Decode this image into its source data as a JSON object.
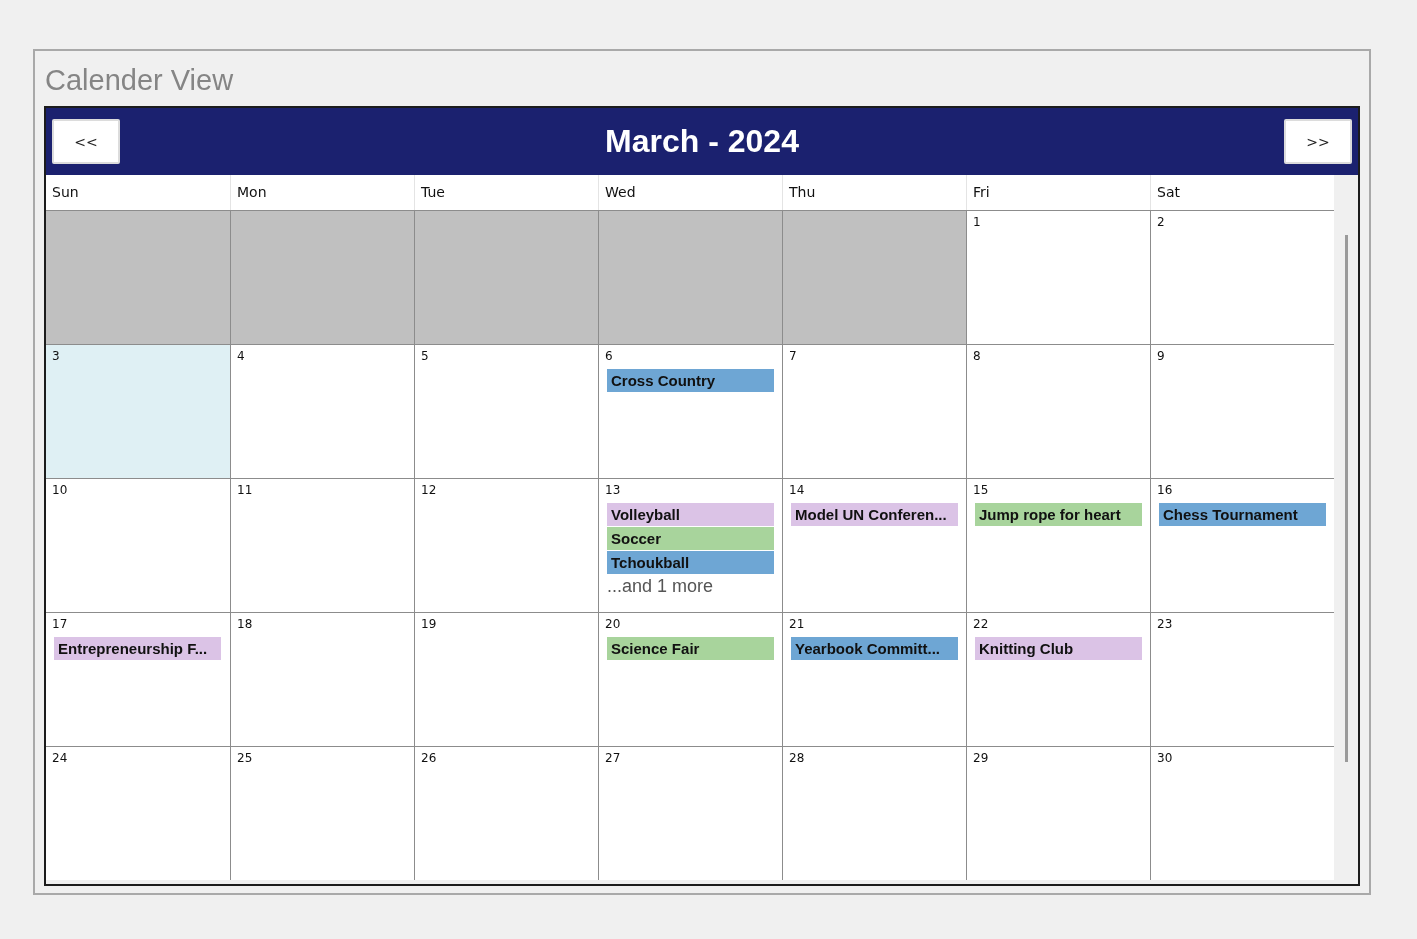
{
  "panel": {
    "title": "Calender View"
  },
  "header": {
    "prev": "<<",
    "month": "March - 2024",
    "next": ">>"
  },
  "weekdays": [
    "Sun",
    "Mon",
    "Tue",
    "Wed",
    "Thu",
    "Fri",
    "Sat"
  ],
  "weeks": [
    [
      {
        "kind": "blank"
      },
      {
        "kind": "blank"
      },
      {
        "kind": "blank"
      },
      {
        "kind": "blank"
      },
      {
        "kind": "blank"
      },
      {
        "kind": "day",
        "day": "1",
        "selected": false
      },
      {
        "kind": "day",
        "day": "2",
        "selected": false
      }
    ],
    [
      {
        "kind": "day",
        "day": "3",
        "selected": true
      },
      {
        "kind": "day",
        "day": "4",
        "selected": false
      },
      {
        "kind": "day",
        "day": "5",
        "selected": false
      },
      {
        "kind": "day",
        "day": "6",
        "selected": false,
        "events": [
          {
            "title": "Cross Country",
            "color": "#6ea6d4"
          }
        ]
      },
      {
        "kind": "day",
        "day": "7",
        "selected": false
      },
      {
        "kind": "day",
        "day": "8",
        "selected": false
      },
      {
        "kind": "day",
        "day": "9",
        "selected": false
      }
    ],
    [
      {
        "kind": "day",
        "day": "10",
        "selected": false
      },
      {
        "kind": "day",
        "day": "11",
        "selected": false
      },
      {
        "kind": "day",
        "day": "12",
        "selected": false
      },
      {
        "kind": "day",
        "day": "13",
        "selected": false,
        "events": [
          {
            "title": "Volleyball",
            "color": "#dbc3e6"
          },
          {
            "title": "Soccer",
            "color": "#a8d49c"
          },
          {
            "title": "Tchoukball",
            "color": "#6ea6d4"
          }
        ],
        "more": "...and 1 more"
      },
      {
        "kind": "day",
        "day": "14",
        "selected": false,
        "events": [
          {
            "title": "Model UN Conferen...",
            "color": "#dbc3e6"
          }
        ]
      },
      {
        "kind": "day",
        "day": "15",
        "selected": false,
        "events": [
          {
            "title": "Jump rope for heart",
            "color": "#a8d49c"
          }
        ]
      },
      {
        "kind": "day",
        "day": "16",
        "selected": false,
        "events": [
          {
            "title": "Chess Tournament",
            "color": "#6ea6d4"
          }
        ]
      }
    ],
    [
      {
        "kind": "day",
        "day": "17",
        "selected": false,
        "events": [
          {
            "title": "Entrepreneurship F...",
            "color": "#dbc3e6"
          }
        ]
      },
      {
        "kind": "day",
        "day": "18",
        "selected": false
      },
      {
        "kind": "day",
        "day": "19",
        "selected": false
      },
      {
        "kind": "day",
        "day": "20",
        "selected": false,
        "events": [
          {
            "title": "Science Fair",
            "color": "#a8d49c"
          }
        ]
      },
      {
        "kind": "day",
        "day": "21",
        "selected": false,
        "events": [
          {
            "title": "Yearbook Committ...",
            "color": "#6ea6d4"
          }
        ]
      },
      {
        "kind": "day",
        "day": "22",
        "selected": false,
        "events": [
          {
            "title": "Knitting Club",
            "color": "#dbc3e6"
          }
        ]
      },
      {
        "kind": "day",
        "day": "23",
        "selected": false
      }
    ],
    [
      {
        "kind": "day",
        "day": "24",
        "selected": false
      },
      {
        "kind": "day",
        "day": "25",
        "selected": false
      },
      {
        "kind": "day",
        "day": "26",
        "selected": false
      },
      {
        "kind": "day",
        "day": "27",
        "selected": false
      },
      {
        "kind": "day",
        "day": "28",
        "selected": false
      },
      {
        "kind": "day",
        "day": "29",
        "selected": false
      },
      {
        "kind": "day",
        "day": "30",
        "selected": false
      }
    ]
  ]
}
